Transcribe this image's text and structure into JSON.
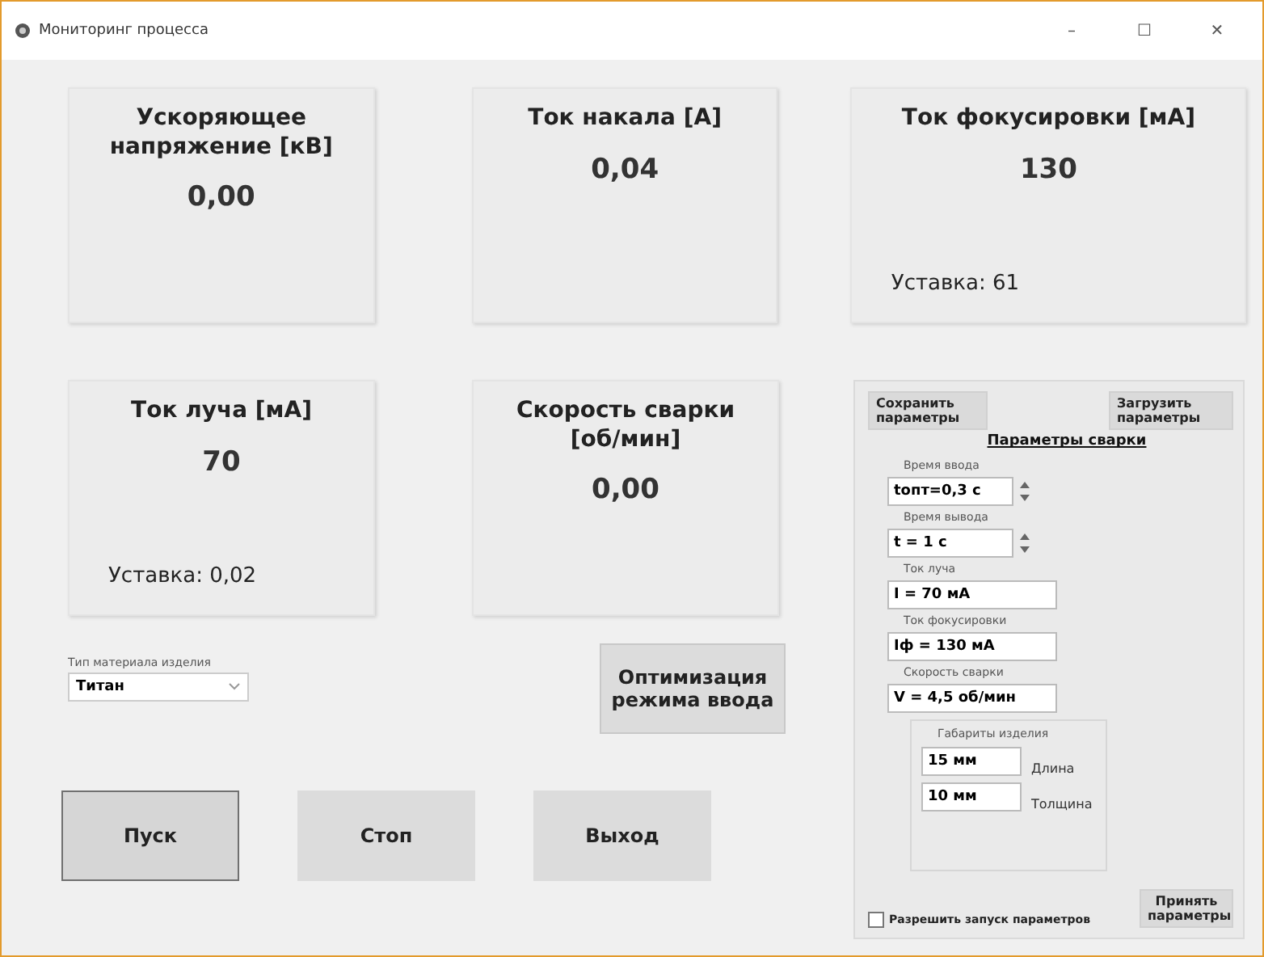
{
  "window": {
    "title": "Мониторинг процесса",
    "controls": [
      "–",
      "☐",
      "✕"
    ]
  },
  "cards_top": [
    {
      "title": "Ускоряющее напряжение [кВ]",
      "value": "0,00"
    },
    {
      "title": "Ток накала [А]",
      "value": "0,04"
    },
    {
      "title": "Ток фокусировки [мА]",
      "value": "130",
      "setpoint": "Уставка: 61"
    }
  ],
  "cards_bottom": [
    {
      "title": "Ток луча [мА]",
      "value": "70",
      "setpoint": "Уставка: 0,02"
    },
    {
      "title": "Скорость сварки [об/мин]",
      "value": "0,00"
    }
  ],
  "material": {
    "label": "Тип материала изделия",
    "value": "Титан"
  },
  "optimize_button": "Оптимизация режима ввода",
  "buttons": [
    {
      "label": "Пуск",
      "selected": true
    },
    {
      "label": "Стоп",
      "selected": false
    },
    {
      "label": "Выход",
      "selected": false
    }
  ],
  "panel": {
    "save_button": "Сохранить параметры",
    "load_button": "Загрузить параметры",
    "title": "Параметры сварки",
    "fields": [
      {
        "kind": "spin",
        "label": "Время ввода",
        "value": "tопт=0,3 с"
      },
      {
        "kind": "spin",
        "label": "Время вывода",
        "value": "t = 1 с"
      },
      {
        "kind": "text",
        "label": "Ток луча",
        "value": "I = 70 мА"
      },
      {
        "kind": "text",
        "label": "Ток фокусировки",
        "value": "Iф = 130 мА"
      },
      {
        "kind": "text",
        "label": "Скорость сварки",
        "value": "V = 4,5 об/мин"
      }
    ],
    "dimensions": {
      "title": "Габариты изделия",
      "rows": [
        {
          "value": "15 мм",
          "label": "Длина"
        },
        {
          "value": "10 мм",
          "label": "Толщина"
        }
      ]
    },
    "allow_checkbox": {
      "label": "Разрешить запуск параметров",
      "checked": false
    },
    "apply_button": "Принять параметры"
  }
}
